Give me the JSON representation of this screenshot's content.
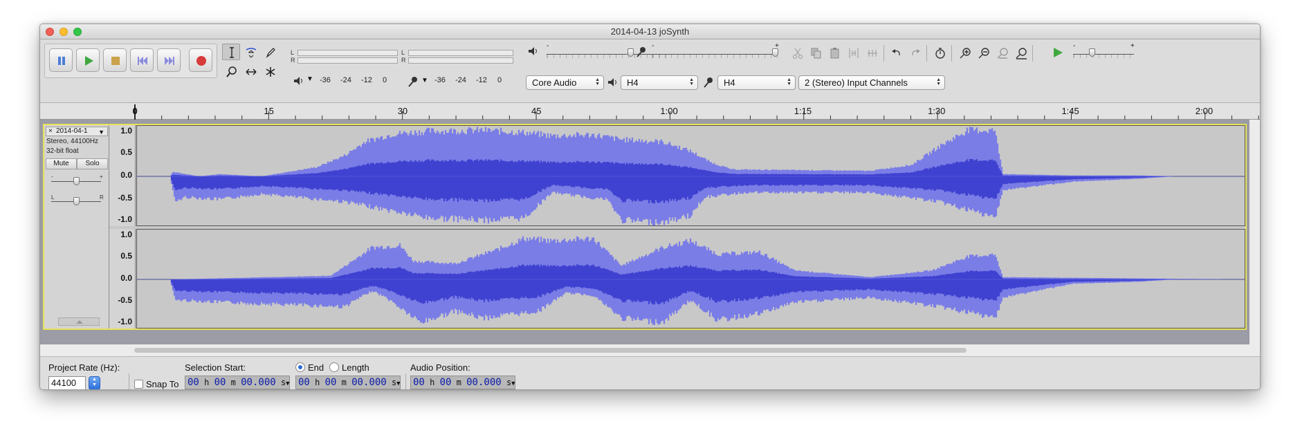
{
  "window": {
    "title": "2014-04-13 joSynth"
  },
  "meters": {
    "playback_lr": [
      "L",
      "R"
    ],
    "record_lr": [
      "L",
      "R"
    ],
    "playback_scale": [
      "-36",
      "-24",
      "-12",
      "0"
    ],
    "record_scale": [
      "-36",
      "-24",
      "-12",
      "0"
    ]
  },
  "mixer": {
    "minus": "-",
    "plus": "+"
  },
  "play_speed": {
    "minus": "-",
    "plus": "+"
  },
  "devices": {
    "host": "Core Audio",
    "playback_device": "H4",
    "recording_device": "H4",
    "channels": "2 (Stereo) Input Channels"
  },
  "ruler": {
    "ticks": [
      {
        "label": "0",
        "t": 0
      },
      {
        "label": "15",
        "t": 15
      },
      {
        "label": "30",
        "t": 30
      },
      {
        "label": "45",
        "t": 45
      },
      {
        "label": "1:00",
        "t": 60
      },
      {
        "label": "1:15",
        "t": 75
      },
      {
        "label": "1:30",
        "t": 90
      },
      {
        "label": "1:45",
        "t": 105
      },
      {
        "label": "2:00",
        "t": 120
      }
    ]
  },
  "track": {
    "name": "2014-04-1",
    "close": "×",
    "menu": "▼",
    "info_line1": "Stereo, 44100Hz",
    "info_line2": "32-bit float",
    "mute_label": "Mute",
    "solo_label": "Solo",
    "gain_minus": "-",
    "gain_plus": "+",
    "pan_left": "L",
    "pan_right": "R",
    "scale_labels": [
      "1.0",
      "0.5",
      "0.0",
      "-0.5",
      "-1.0"
    ],
    "wave_color": "#7a7de6",
    "rms_color": "#3f42d0"
  },
  "selection_bar": {
    "project_rate_label": "Project Rate (Hz):",
    "project_rate_value": "44100",
    "snap_to_label": "Snap To",
    "selection_start_label": "Selection Start:",
    "end_label": "End",
    "length_label": "Length",
    "audio_position_label": "Audio Position:",
    "time_h": "00",
    "time_m": "00",
    "time_s": "00.000",
    "unit_h": "h",
    "unit_m": "m",
    "unit_s": "s"
  }
}
